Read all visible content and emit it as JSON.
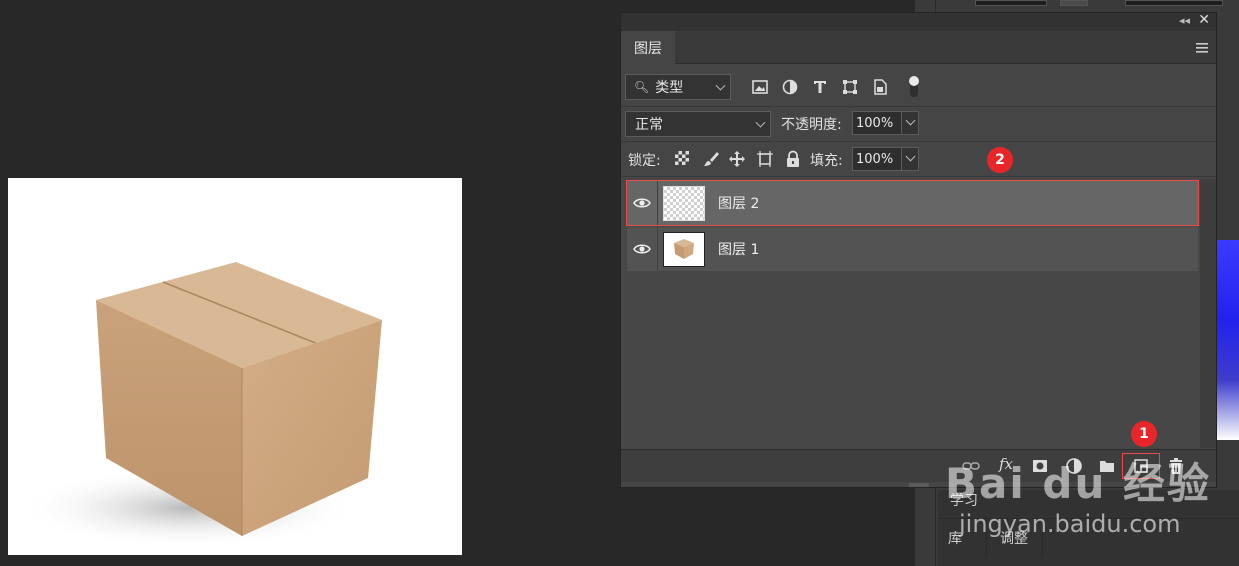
{
  "panel": {
    "tab_label": "图层",
    "filter": {
      "label": "类型"
    },
    "blend_mode": "正常",
    "opacity": {
      "label": "不透明度:",
      "value": "100%"
    },
    "lock": {
      "label": "锁定:"
    },
    "fill": {
      "label": "填充:",
      "value": "100%"
    },
    "layers": [
      {
        "name": "图层 2",
        "selected": true,
        "thumbnail": "transparent-checker"
      },
      {
        "name": "图层 1",
        "selected": false,
        "thumbnail": "box-image"
      }
    ],
    "footer_icons": [
      "link-icon",
      "fx-icon",
      "mask-icon",
      "adjustment-icon",
      "folder-icon",
      "new-layer-icon",
      "trash-icon"
    ]
  },
  "side": {
    "tab_library": "库",
    "tab_adjust": "调整",
    "tab_learn": "学习"
  },
  "annotations": {
    "badge_1": "1",
    "badge_2": "2"
  },
  "watermark": {
    "brand": "Bai du 经验",
    "url": "jingyan.baidu.com"
  },
  "colors": {
    "accent_red": "#e8262a",
    "selection_outline": "#e84b4b",
    "panel_bg": "#454545"
  }
}
